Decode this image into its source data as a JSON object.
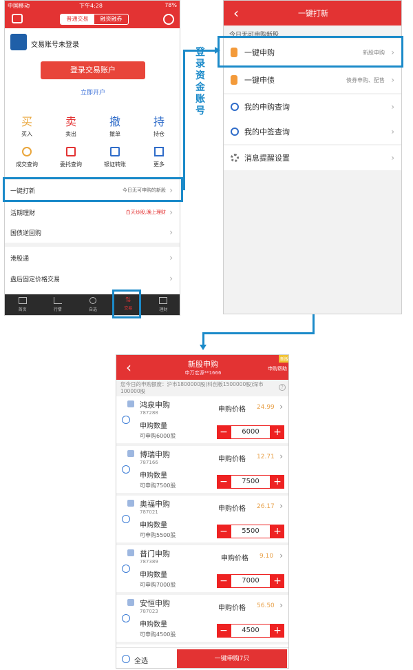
{
  "screen1": {
    "status": {
      "carrier": "中国移动",
      "time": "下午4:28",
      "battery": "78%"
    },
    "tabs": [
      "普通交易",
      "融资融券"
    ],
    "account_status": "交易账号未登录",
    "login_button": "登录交易账户",
    "open_account": "立即开户",
    "actions": [
      {
        "glyph": "买",
        "label": "买入"
      },
      {
        "glyph": "卖",
        "label": "卖出"
      },
      {
        "glyph": "撤",
        "label": "撤单"
      },
      {
        "glyph": "持",
        "label": "持仓"
      }
    ],
    "tools": [
      "成交查询",
      "委托查询",
      "银证转账",
      "更多"
    ],
    "menu": [
      {
        "label": "一键打新",
        "note": "今日无可申购的新股"
      },
      {
        "label": "活期理财",
        "note": "白天炒股,晚上理财"
      },
      {
        "label": "国债逆回购",
        "note": ""
      },
      {
        "label": "港股通",
        "note": ""
      },
      {
        "label": "盘后固定价格交易",
        "note": ""
      }
    ],
    "bottom_nav": [
      "首页",
      "行情",
      "自选",
      "交易",
      "理财"
    ]
  },
  "annotation": "登录资金账号",
  "screen2": {
    "title": "一键打新",
    "notice": "今日无可申购新股",
    "items": [
      {
        "label": "一键申购",
        "note": "新股申购"
      },
      {
        "label": "一键申债",
        "note": "债券申购、配售"
      },
      {
        "label": "我的申购查询",
        "note": ""
      },
      {
        "label": "我的中签查询",
        "note": ""
      },
      {
        "label": "消息提醒设置",
        "note": ""
      }
    ]
  },
  "screen3": {
    "title": "新股申购",
    "subtitle": "申万宏源**1666",
    "help": "申购帮助",
    "badge": "新版",
    "quota": "您今日的申购额度：沪市1800000股(科创板1500000股)深市100000股",
    "price_label": "申购价格",
    "qty_label": "申购数量",
    "stocks": [
      {
        "name": "鸿泉申购",
        "code": "787288",
        "price": "24.99",
        "avail": "可申购6000股",
        "qty": "6000"
      },
      {
        "name": "博瑞申购",
        "code": "787166",
        "price": "12.71",
        "avail": "可申购7500股",
        "qty": "7500"
      },
      {
        "name": "奥福申购",
        "code": "787021",
        "price": "26.17",
        "avail": "可申购5500股",
        "qty": "5500"
      },
      {
        "name": "普门申购",
        "code": "787389",
        "price": "9.10",
        "avail": "可申购7000股",
        "qty": "7000"
      },
      {
        "name": "安恒申购",
        "code": "787023",
        "price": "56.50",
        "avail": "可申购4500股",
        "qty": "4500"
      }
    ],
    "select_all": "全选",
    "submit": "一键申购7只"
  },
  "colors": {
    "brand_red": "#e33333",
    "callout_blue": "#1b8ac9",
    "price_orange": "#e8a14a"
  }
}
